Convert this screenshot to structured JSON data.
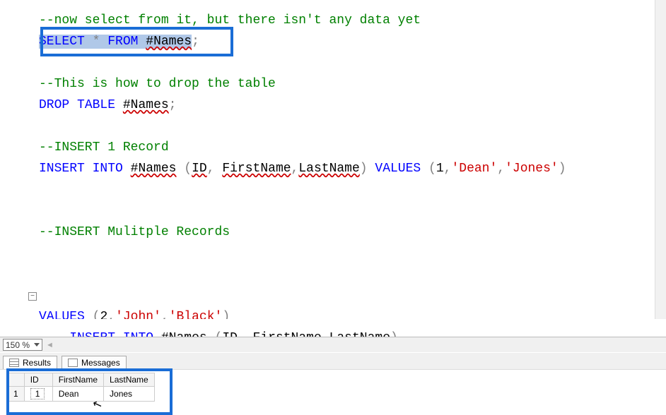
{
  "editor": {
    "lines": [
      {
        "t": "comment",
        "text": "--now select from it, but there isn't any data yet"
      },
      {
        "t": "select",
        "select": "SELECT",
        "star": "*",
        "from": "FROM",
        "table": "#Names",
        "semi": ";"
      },
      {
        "t": "blank",
        "text": ""
      },
      {
        "t": "comment",
        "text": "--This is how to drop the table"
      },
      {
        "t": "drop",
        "drop": "DROP",
        "table_kw": "TABLE",
        "table": "#Names",
        "semi": ";"
      },
      {
        "t": "blank",
        "text": ""
      },
      {
        "t": "comment",
        "text": "--INSERT 1 Record"
      },
      {
        "t": "insert1",
        "insert": "INSERT",
        "into": "INTO",
        "table": "#Names",
        "lp": "(",
        "c1": "ID",
        "cm1": ",",
        "c2": "FirstName",
        "cm2": ",",
        "c3": "LastName",
        "rp": ")",
        "values": "VALUES",
        "lp2": "(",
        "v1": "1",
        "cm3": ",",
        "v2": "'Dean'",
        "cm4": ",",
        "v3": "'Jones'",
        "rp2": ")"
      },
      {
        "t": "blank",
        "text": ""
      },
      {
        "t": "blank",
        "text": ""
      },
      {
        "t": "comment",
        "text": "--INSERT Mulitple Records"
      },
      {
        "t": "blank",
        "text": ""
      },
      {
        "t": "blank",
        "text": ""
      },
      {
        "t": "inserthead",
        "insert": "INSERT",
        "into": "INTO",
        "table": "#Names",
        "lp": "(",
        "c1": "ID",
        "cm1": ",",
        "c2": "FirstName",
        "cm2": ",",
        "c3": "LastName",
        "rp": ")"
      },
      {
        "t": "valuesline",
        "values": "VALUES",
        "lp": "(",
        "v1": "2",
        "cm1": ",",
        "v2": "'John'",
        "cm2": ",",
        "v3": "'Black'",
        "rp": ")"
      }
    ]
  },
  "zoom": {
    "level": "150 %"
  },
  "tabs": {
    "results": "Results",
    "messages": "Messages"
  },
  "grid": {
    "headers": {
      "rownum": "",
      "id": "ID",
      "first": "FirstName",
      "last": "LastName"
    },
    "rows": [
      {
        "n": "1",
        "id": "1",
        "first": "Dean",
        "last": "Jones"
      }
    ]
  }
}
